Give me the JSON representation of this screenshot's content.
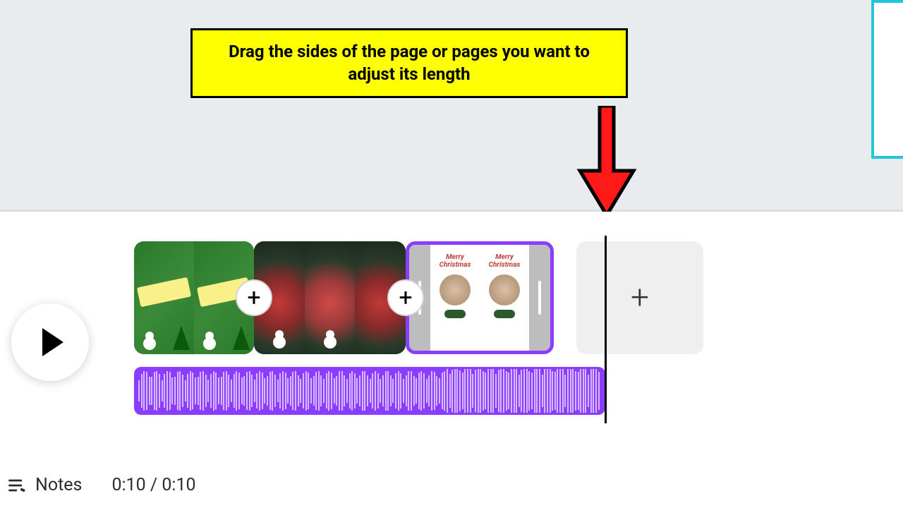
{
  "annotation": {
    "callout_text": "Drag the sides of the page or pages you want to adjust its length"
  },
  "timeline": {
    "play_label": "Play",
    "clips": [
      {
        "name": "page-1",
        "theme": "christmas-green"
      },
      {
        "name": "page-2",
        "theme": "christmas-ornament"
      },
      {
        "name": "page-3",
        "theme": "christmas-card",
        "selected": true
      }
    ],
    "add_page_label": "+",
    "transition_label": "+",
    "audio": {
      "name": "audio-track-1",
      "color": "#8b3dff"
    }
  },
  "footer": {
    "notes_label": "Notes",
    "time_current": "0:10",
    "time_total": "0:10",
    "time_display": "0:10 / 0:10"
  },
  "colors": {
    "selection": "#8b3dff",
    "highlight": "#feff00",
    "canvas_border": "#21c7d8"
  }
}
